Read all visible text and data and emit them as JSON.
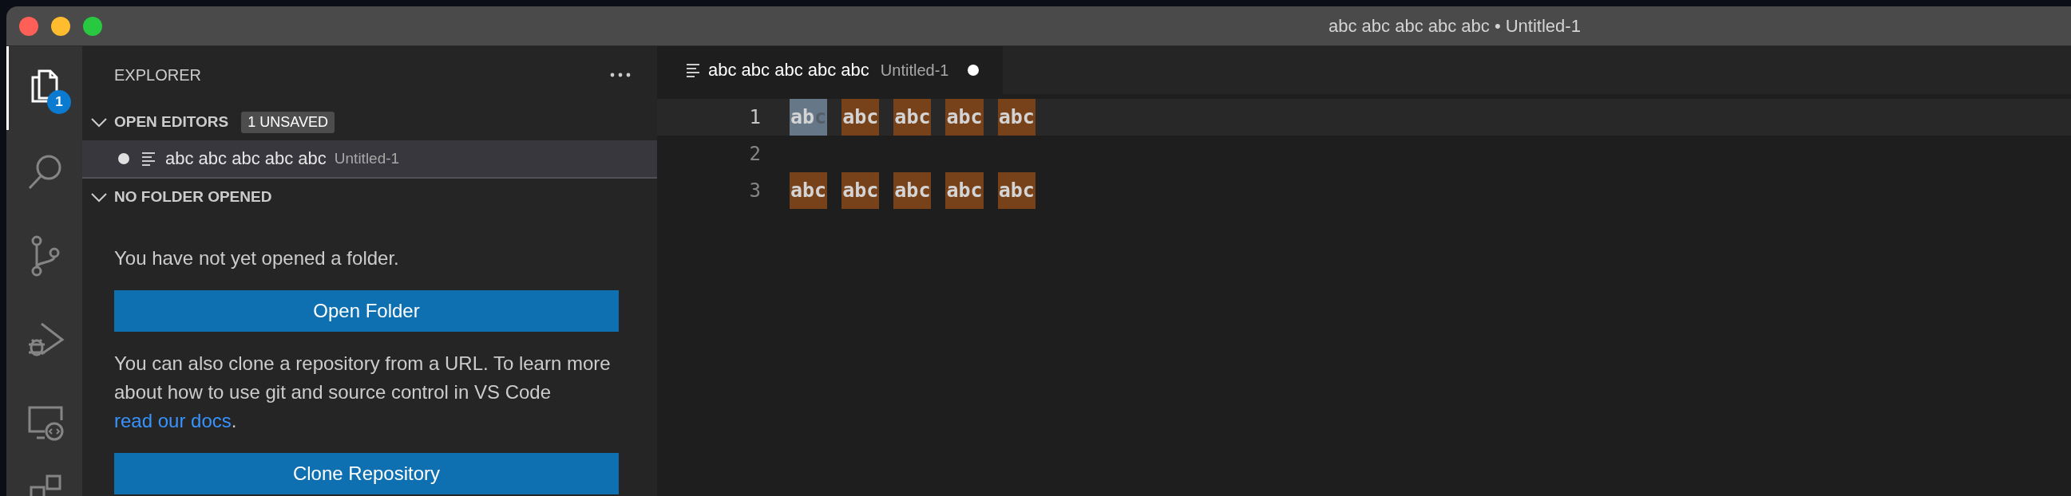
{
  "window": {
    "title": "abc abc abc abc abc • Untitled-1"
  },
  "activity_bar": {
    "items": [
      {
        "kind": "explorer",
        "selected": true,
        "badge": "1"
      },
      {
        "kind": "search",
        "selected": false
      },
      {
        "kind": "source_control",
        "selected": false
      },
      {
        "kind": "run_debug",
        "selected": false
      },
      {
        "kind": "remote",
        "selected": false
      },
      {
        "kind": "extensions",
        "selected": false
      }
    ]
  },
  "sidebar": {
    "title": "EXPLORER",
    "open_editors": {
      "title": "OPEN EDITORS",
      "expanded": true,
      "badge": "1 UNSAVED",
      "items": [
        {
          "name": "abc abc abc abc abc",
          "description": "Untitled-1",
          "dirty": true,
          "selected": true
        }
      ]
    },
    "no_folder": {
      "title": "NO FOLDER OPENED",
      "expanded": true,
      "blocks": [
        {
          "kind": "text",
          "text": "You have not yet opened a folder."
        },
        {
          "kind": "button",
          "text": "Open Folder"
        },
        {
          "kind": "text",
          "text": "You can also clone a repository from a URL. To learn more about how to use git and source control in VS Code ",
          "link": "read our docs",
          "after": "."
        },
        {
          "kind": "button",
          "text": "Clone Repository"
        }
      ]
    }
  },
  "editor": {
    "tabs": [
      {
        "name": "abc abc abc abc abc",
        "description": "Untitled-1",
        "dirty": true,
        "selected": true
      }
    ],
    "lines": [
      {
        "number": "1",
        "current": true,
        "tokens": [
          {
            "kind": "selection",
            "text": "ab",
            "ghost": "c"
          },
          {
            "kind": "match",
            "text": "abc"
          },
          {
            "kind": "match",
            "text": "abc"
          },
          {
            "kind": "match",
            "text": "abc"
          },
          {
            "kind": "match",
            "text": "abc"
          }
        ]
      },
      {
        "number": "2",
        "current": false
      },
      {
        "number": "3",
        "current": false,
        "tokens": [
          {
            "kind": "match",
            "text": "abc"
          },
          {
            "kind": "match",
            "text": "abc"
          },
          {
            "kind": "match",
            "text": "abc"
          },
          {
            "kind": "match",
            "text": "abc"
          },
          {
            "kind": "match",
            "text": "abc"
          }
        ]
      }
    ]
  }
}
